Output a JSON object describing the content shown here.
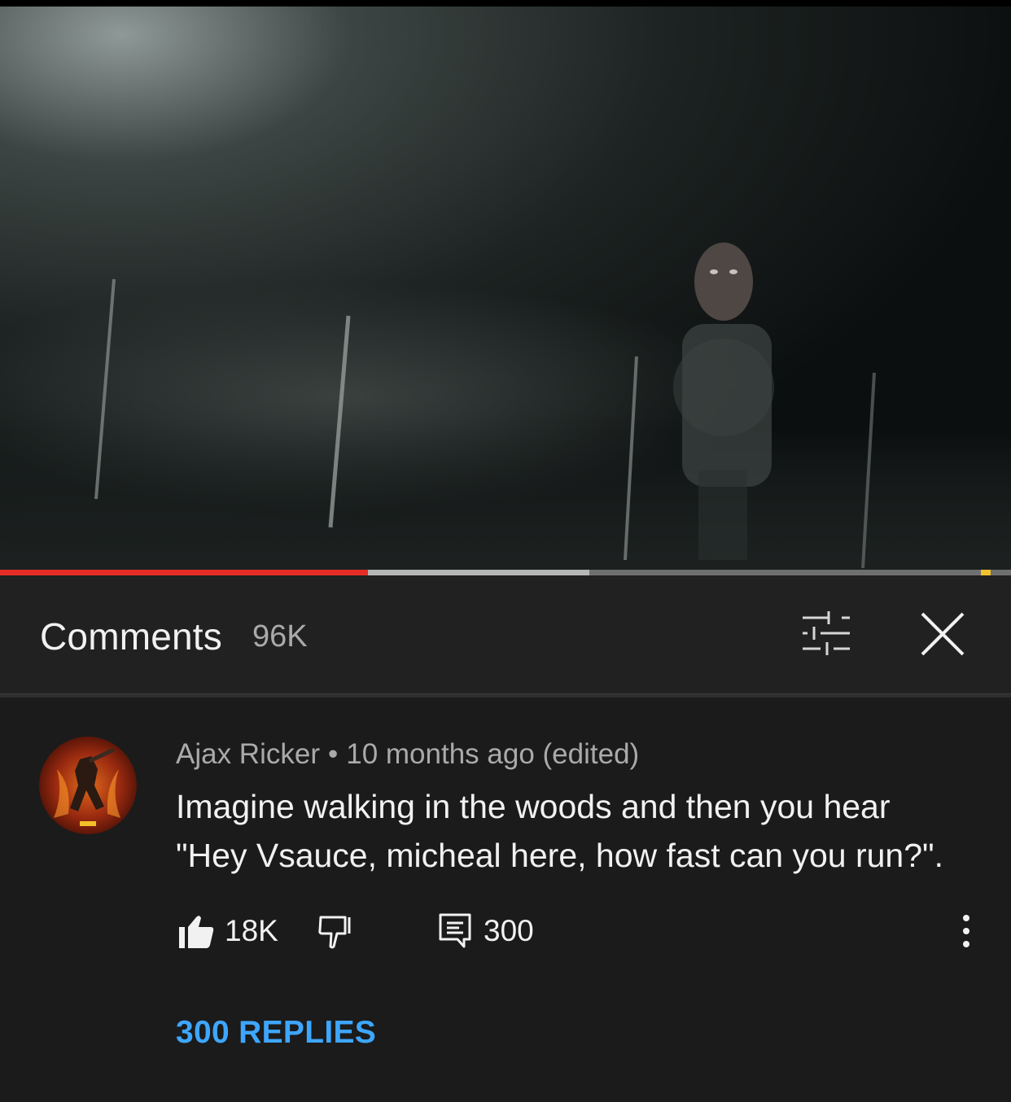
{
  "video": {
    "progress_played_fraction": 0.364,
    "progress_buffered_fraction": 0.583,
    "ad_marker_fraction": 0.97
  },
  "comments_panel": {
    "title": "Comments",
    "count": "96K",
    "filter_icon": "sliders-icon",
    "close_icon": "close-icon"
  },
  "comment": {
    "author": "Ajax Ricker",
    "separator": "•",
    "timestamp": "10 months ago (edited)",
    "text_line1": "Imagine walking in the woods and then you hear",
    "text_line2": "\"Hey Vsauce,  micheal here, how fast can you run?\".",
    "likes": "18K",
    "reply_count": "300",
    "replies_link": "300 REPLIES",
    "colors": {
      "link": "#3ea6ff",
      "progress": "#e52d27",
      "meta": "#aaaaaa"
    }
  }
}
